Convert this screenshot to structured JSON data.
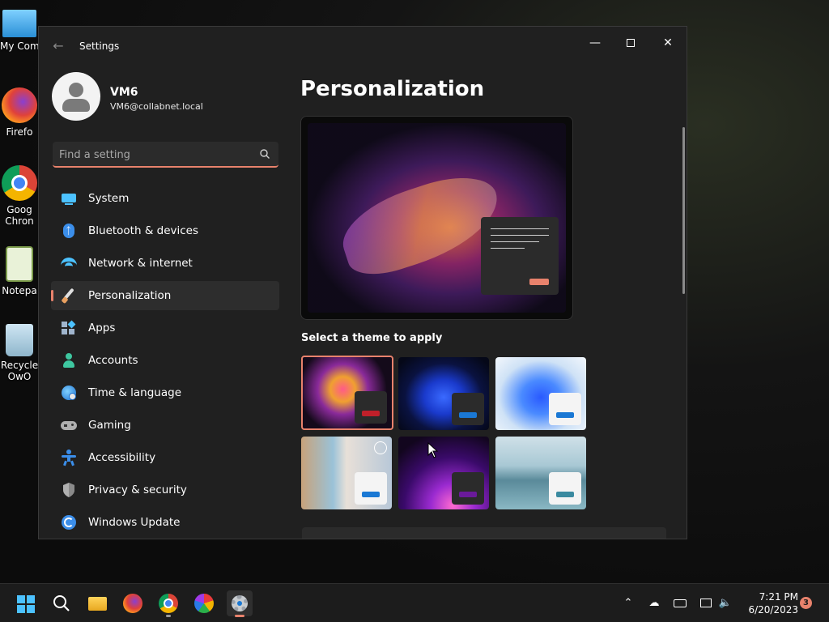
{
  "desktop": {
    "icons": [
      {
        "label": "My Com",
        "icon": "computer-icon"
      },
      {
        "label": "Firefo",
        "icon": "firefox-icon"
      },
      {
        "label": "Goog",
        "label2": "Chron",
        "icon": "chrome-icon"
      },
      {
        "label": "Notepa",
        "icon": "notepad-icon"
      },
      {
        "label": "Recycle",
        "label2": "OwO",
        "icon": "recycle-bin-icon"
      }
    ]
  },
  "window": {
    "title": "Settings",
    "controls": {
      "minimize": "minimize-icon",
      "maximize": "maximize-icon",
      "close": "close-icon"
    }
  },
  "profile": {
    "name": "VM6",
    "email": "VM6@collabnet.local"
  },
  "search": {
    "placeholder": "Find a setting",
    "value": ""
  },
  "sidebar": {
    "items": [
      {
        "label": "System",
        "icon": "system-icon",
        "color": "#4cc2ff"
      },
      {
        "label": "Bluetooth & devices",
        "icon": "bluetooth-icon",
        "color": "#3b8eea"
      },
      {
        "label": "Network & internet",
        "icon": "wifi-icon",
        "color": "#4cc2ff"
      },
      {
        "label": "Personalization",
        "icon": "brush-icon",
        "color": "#e8a060",
        "active": true
      },
      {
        "label": "Apps",
        "icon": "apps-icon",
        "color": "#9fb4cc"
      },
      {
        "label": "Accounts",
        "icon": "accounts-icon",
        "color": "#3ec7a0"
      },
      {
        "label": "Time & language",
        "icon": "globe-clock-icon",
        "color": "#3b8eea"
      },
      {
        "label": "Gaming",
        "icon": "gamepad-icon",
        "color": "#b0b0b0"
      },
      {
        "label": "Accessibility",
        "icon": "accessibility-icon",
        "color": "#3b8eea"
      },
      {
        "label": "Privacy & security",
        "icon": "shield-icon",
        "color": "#b0b0b0"
      },
      {
        "label": "Windows Update",
        "icon": "update-icon",
        "color": "#3b8eea"
      }
    ]
  },
  "content": {
    "title": "Personalization",
    "themes_heading": "Select a theme to apply",
    "themes": [
      {
        "name": "theme-glow-flower",
        "accent": "#c0202a",
        "selected": true
      },
      {
        "name": "theme-blue-bloom-dark",
        "accent": "#1a78d4"
      },
      {
        "name": "theme-blue-bloom-light",
        "accent": "#1a78d4"
      },
      {
        "name": "theme-captured-motion",
        "accent": "#1a78d4",
        "slideshow": true
      },
      {
        "name": "theme-sunrise-purple",
        "accent": "#6a1a9a"
      },
      {
        "name": "theme-flow-lake",
        "accent": "#3a8aa0"
      }
    ]
  },
  "taskbar": {
    "apps": [
      "start-icon",
      "search-icon",
      "file-explorer-icon",
      "firefox-icon",
      "chrome-icon",
      "photos-icon",
      "settings-icon"
    ],
    "tray": [
      "chevron-up-icon",
      "cloud-off-icon",
      "keyboard-icon",
      "network-icon",
      "volume-icon"
    ],
    "time": "7:21 PM",
    "date": "6/20/2023",
    "notifications": "3"
  },
  "colors": {
    "accent": "#e8826c",
    "window_bg": "#202020",
    "taskbar_bg": "#1c1c1c"
  }
}
